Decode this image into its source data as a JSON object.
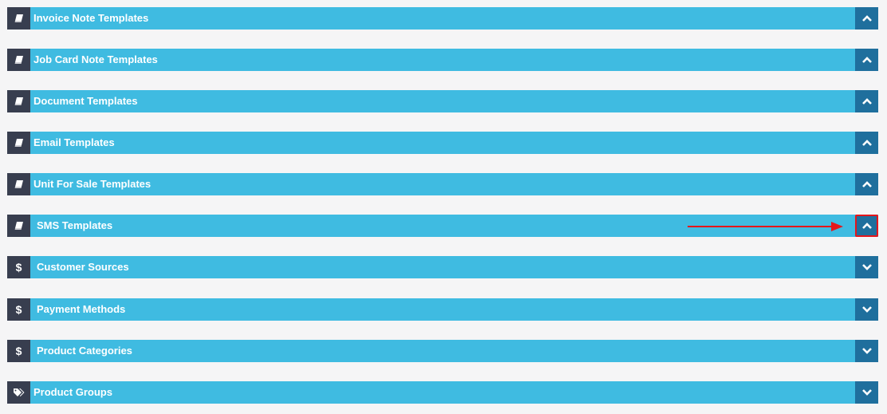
{
  "panels": [
    {
      "title": "Invoice Note Templates",
      "icon": "book-icon",
      "state": "expanded"
    },
    {
      "title": "Job Card Note Templates",
      "icon": "book-icon",
      "state": "expanded"
    },
    {
      "title": "Document Templates",
      "icon": "book-icon",
      "state": "expanded"
    },
    {
      "title": "Email Templates",
      "icon": "book-icon",
      "state": "expanded"
    },
    {
      "title": "Unit For Sale Templates",
      "icon": "book-icon",
      "state": "expanded"
    },
    {
      "title": "SMS Templates",
      "icon": "book-icon",
      "state": "expanded"
    },
    {
      "title": "Customer Sources",
      "icon": "dollar-icon",
      "state": "collapsed"
    },
    {
      "title": "Payment Methods",
      "icon": "dollar-icon",
      "state": "collapsed"
    },
    {
      "title": "Product Categories",
      "icon": "dollar-icon",
      "state": "collapsed"
    },
    {
      "title": "Product Groups",
      "icon": "tags-icon",
      "state": "collapsed"
    }
  ],
  "dollar_symbol": "$",
  "colors": {
    "header_bg": "#3fbbe1",
    "icon_bg": "#383e4f",
    "toggle_bg": "#1f6f9d",
    "highlight": "#e4161b",
    "page_bg": "#f5f5f6"
  }
}
